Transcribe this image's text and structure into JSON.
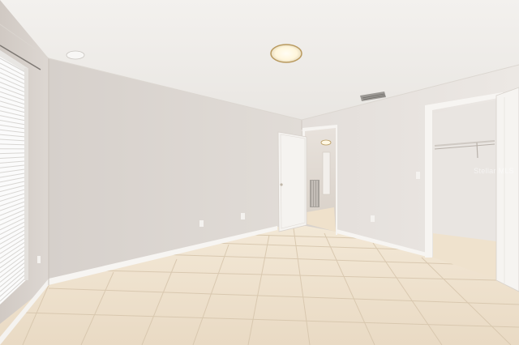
{
  "scene": {
    "description_hidden": "",
    "colors": {
      "ceiling": "#f0eeeb",
      "wall_left": "#d9d3ce",
      "wall_back": "#dcd6d1",
      "wall_right": "#e2ddd8",
      "floor_tile": "#efe3d0",
      "grout": "#d9c9b2",
      "trim": "#f7f5f2",
      "door": "#f4f2ef"
    },
    "watermark": "Stellar MLS"
  }
}
